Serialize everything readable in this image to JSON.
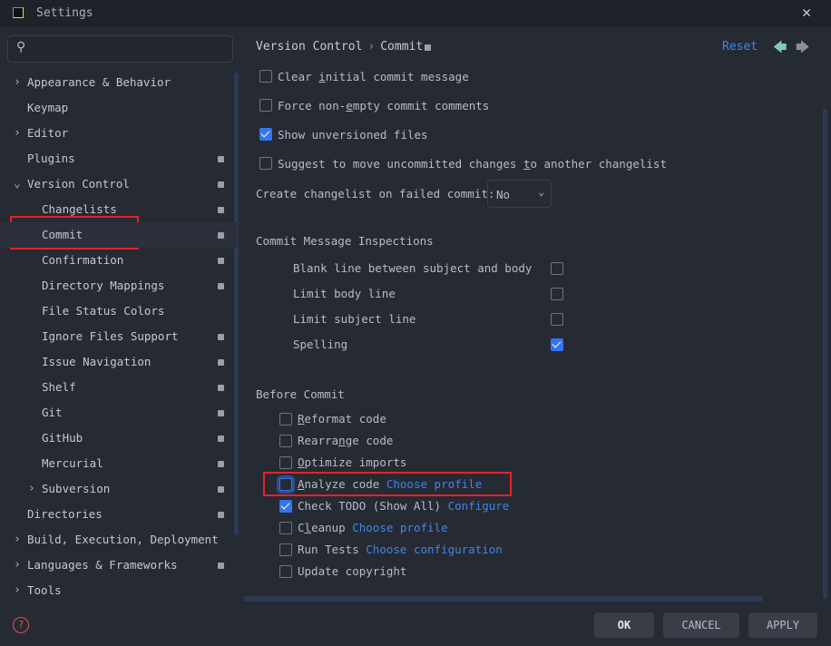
{
  "window": {
    "title": "Settings",
    "close": "✕"
  },
  "search": {
    "placeholder": ""
  },
  "sidebar": {
    "items": [
      {
        "label": "Appearance & Behavior",
        "arrow": "›",
        "proj": false
      },
      {
        "label": "Keymap",
        "arrow": "",
        "proj": false
      },
      {
        "label": "Editor",
        "arrow": "›",
        "proj": false
      },
      {
        "label": "Plugins",
        "arrow": "",
        "proj": true
      },
      {
        "label": "Version Control",
        "arrow": "⌄",
        "proj": true
      },
      {
        "label": "Changelists",
        "arrow": "",
        "proj": true,
        "child": true
      },
      {
        "label": "Commit",
        "arrow": "",
        "proj": true,
        "child": true,
        "selected": true
      },
      {
        "label": "Confirmation",
        "arrow": "",
        "proj": true,
        "child": true
      },
      {
        "label": "Directory Mappings",
        "arrow": "",
        "proj": true,
        "child": true
      },
      {
        "label": "File Status Colors",
        "arrow": "",
        "proj": false,
        "child": true
      },
      {
        "label": "Ignore Files Support",
        "arrow": "",
        "proj": true,
        "child": true
      },
      {
        "label": "Issue Navigation",
        "arrow": "",
        "proj": true,
        "child": true
      },
      {
        "label": "Shelf",
        "arrow": "",
        "proj": true,
        "child": true
      },
      {
        "label": "Git",
        "arrow": "",
        "proj": true,
        "child": true
      },
      {
        "label": "GitHub",
        "arrow": "",
        "proj": true,
        "child": true
      },
      {
        "label": "Mercurial",
        "arrow": "",
        "proj": true,
        "child": true
      },
      {
        "label": "Subversion",
        "arrow": "›",
        "proj": true,
        "child": true
      },
      {
        "label": "Directories",
        "arrow": "",
        "proj": true
      },
      {
        "label": "Build, Execution, Deployment",
        "arrow": "›",
        "proj": false
      },
      {
        "label": "Languages & Frameworks",
        "arrow": "›",
        "proj": true
      },
      {
        "label": "Tools",
        "arrow": "›",
        "proj": false
      }
    ]
  },
  "header": {
    "crumb1": "Version Control",
    "sep": "›",
    "crumb2": "Commit",
    "reset": "Reset",
    "back": "🡄",
    "forward": "🡆"
  },
  "options": [
    {
      "pre": "Clear ",
      "u": "i",
      "post": "nitial commit message",
      "checked": false
    },
    {
      "pre": "Force non-",
      "u": "e",
      "post": "mpty commit comments",
      "checked": false
    },
    {
      "pre": "Show unversioned files",
      "u": "",
      "post": "",
      "checked": true
    },
    {
      "pre": "Suggest to move uncommitted changes ",
      "u": "t",
      "post": "o another changelist",
      "checked": false
    }
  ],
  "changelist_on_fail": {
    "label": "Create changelist on failed commit:",
    "value": "No"
  },
  "inspections": {
    "title": "Commit Message Inspections",
    "items": [
      {
        "label": "Blank line between subject and body",
        "checked": false
      },
      {
        "label": "Limit body line",
        "checked": false
      },
      {
        "label": "Limit subject line",
        "checked": false
      },
      {
        "label": "Spelling",
        "checked": true
      }
    ]
  },
  "before_commit": {
    "title": "Before Commit",
    "items": [
      {
        "pre": "",
        "u": "R",
        "post": "eformat code",
        "link": "",
        "checked": false
      },
      {
        "pre": "Rearra",
        "u": "n",
        "post": "ge code",
        "link": "",
        "checked": false
      },
      {
        "pre": "",
        "u": "O",
        "post": "ptimize imports",
        "link": "",
        "checked": false
      },
      {
        "pre": "",
        "u": "A",
        "post": "nalyze code",
        "link": "Choose profile",
        "checked": false,
        "focus": true
      },
      {
        "pre": "Check TODO (Show All)",
        "u": "",
        "post": "",
        "link": "Configure",
        "checked": true
      },
      {
        "pre": "C",
        "u": "l",
        "post": "eanup",
        "link": "Choose profile",
        "checked": false
      },
      {
        "pre": "Run Tests",
        "u": "",
        "post": "",
        "link": "Choose configuration",
        "checked": false
      },
      {
        "pre": "Update copyright",
        "u": "",
        "post": "",
        "link": "",
        "checked": false
      }
    ]
  },
  "buttons": {
    "ok": "OK",
    "cancel": "CANCEL",
    "apply": "APPLY",
    "help": "?"
  }
}
